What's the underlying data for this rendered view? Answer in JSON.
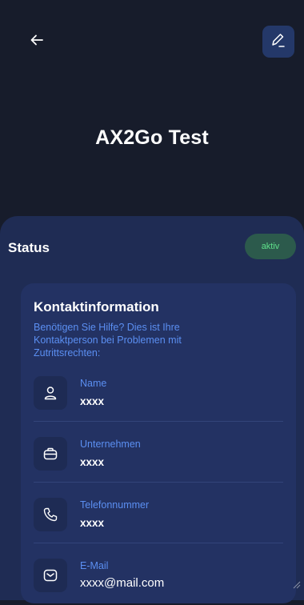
{
  "header": {
    "back_icon": "arrow-left-icon",
    "edit_icon": "pencil-icon",
    "title": "AX2Go Test"
  },
  "status": {
    "label": "Status",
    "badge": "aktiv"
  },
  "contact": {
    "title": "Kontaktinformation",
    "subtitle": "Benötigen Sie Hilfe? Dies ist Ihre Kontaktperson bei Problemen mit Zutrittsrechten:",
    "items": [
      {
        "label": "Name",
        "value": "xxxx",
        "icon": "person-icon"
      },
      {
        "label": "Unternehmen",
        "value": "xxxx",
        "icon": "briefcase-icon"
      },
      {
        "label": "Telefonnummer",
        "value": "xxxx",
        "icon": "phone-icon"
      },
      {
        "label": "E-Mail",
        "value": "xxxx@mail.com",
        "icon": "mail-icon"
      }
    ]
  },
  "colors": {
    "background": "#171c2b",
    "sheet": "#1f2c54",
    "card": "#233263",
    "accent": "#5b8ff2",
    "status_green": "#5fe08a"
  }
}
